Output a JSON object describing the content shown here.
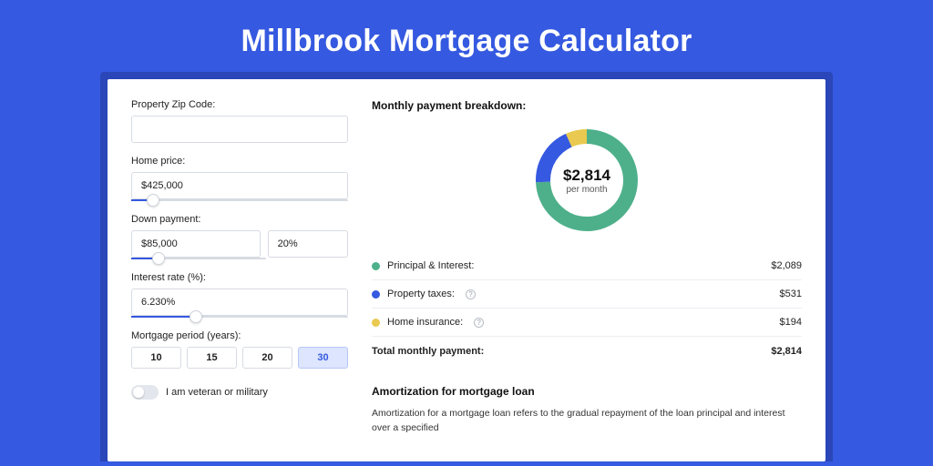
{
  "title": "Millbrook Mortgage Calculator",
  "form": {
    "zip_label": "Property Zip Code:",
    "zip_value": "",
    "home_price_label": "Home price:",
    "home_price_value": "$425,000",
    "home_price_slider_pct": 10,
    "down_payment_label": "Down payment:",
    "down_payment_value": "$85,000",
    "down_payment_pct": "20%",
    "down_payment_slider_pct": 20,
    "interest_label": "Interest rate (%):",
    "interest_value": "6.230%",
    "interest_slider_pct": 30,
    "period_label": "Mortgage period (years):",
    "period_options": [
      "10",
      "15",
      "20",
      "30"
    ],
    "period_selected": "30",
    "veteran_label": "I am veteran or military"
  },
  "breakdown": {
    "title": "Monthly payment breakdown:",
    "donut_amount": "$2,814",
    "donut_sub": "per month",
    "items": [
      {
        "label": "Principal & Interest:",
        "value": "$2,089",
        "color": "#4eb08b",
        "info": false
      },
      {
        "label": "Property taxes:",
        "value": "$531",
        "color": "#3559E0",
        "info": true
      },
      {
        "label": "Home insurance:",
        "value": "$194",
        "color": "#e9c94f",
        "info": true
      }
    ],
    "total_label": "Total monthly payment:",
    "total_value": "$2,814"
  },
  "chart_data": {
    "type": "pie",
    "title": "Monthly payment breakdown",
    "series": [
      {
        "name": "Principal & Interest",
        "value": 2089,
        "color": "#4eb08b"
      },
      {
        "name": "Property taxes",
        "value": 531,
        "color": "#3559E0"
      },
      {
        "name": "Home insurance",
        "value": 194,
        "color": "#e9c94f"
      }
    ],
    "total": 2814,
    "center_label": "$2,814 per month"
  },
  "amortization": {
    "title": "Amortization for mortgage loan",
    "body": "Amortization for a mortgage loan refers to the gradual repayment of the loan principal and interest over a specified"
  }
}
